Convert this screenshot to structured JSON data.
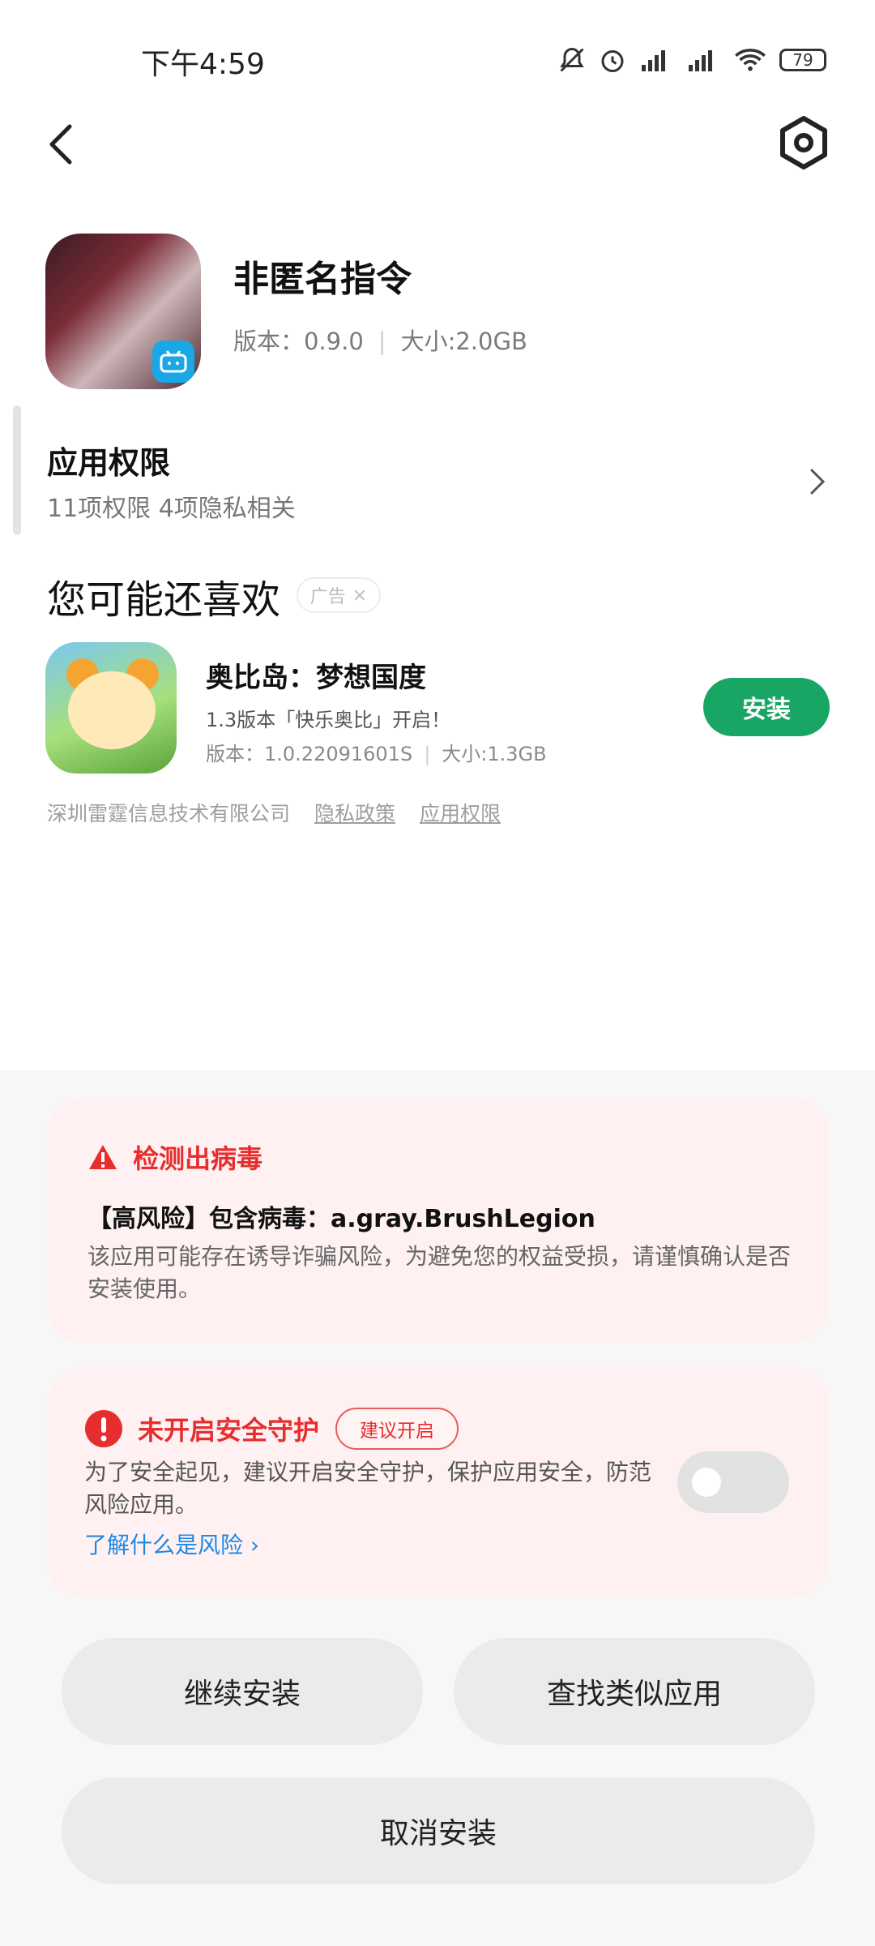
{
  "status_bar": {
    "time": "下午4:59",
    "battery": "79"
  },
  "app": {
    "name": "非匿名指令",
    "version": "版本：0.9.0",
    "size": "大小:2.0GB"
  },
  "permissions": {
    "title": "应用权限",
    "summary": "11项权限 4项隐私相关"
  },
  "recommend": {
    "title": "您可能还喜欢",
    "ad_tag": "广告",
    "app": {
      "name": "奥比岛：梦想国度",
      "desc": "1.3版本「快乐奥比」开启！",
      "version": "版本：1.0.22091601S",
      "size": "大小:1.3GB",
      "install_label": "安装"
    },
    "developer": "深圳雷霆信息技术有限公司",
    "privacy_link": "隐私政策",
    "permission_link": "应用权限"
  },
  "virus_card": {
    "title": "检测出病毒",
    "line": "【高风险】包含病毒：a.gray.BrushLegion",
    "desc": "该应用可能存在诱导诈骗风险，为避免您的权益受损，请谨慎确认是否安装使用。"
  },
  "guard_card": {
    "title": "未开启安全守护",
    "tag": "建议开启",
    "desc": "为了安全起见，建议开启安全守护，保护应用安全，防范风险应用。",
    "link": "了解什么是风险",
    "enabled": false
  },
  "buttons": {
    "continue": "继续安装",
    "similar": "查找类似应用",
    "cancel": "取消安装"
  },
  "colors": {
    "danger": "#e62e2e",
    "install": "#19a664",
    "link": "#1e88e5"
  }
}
